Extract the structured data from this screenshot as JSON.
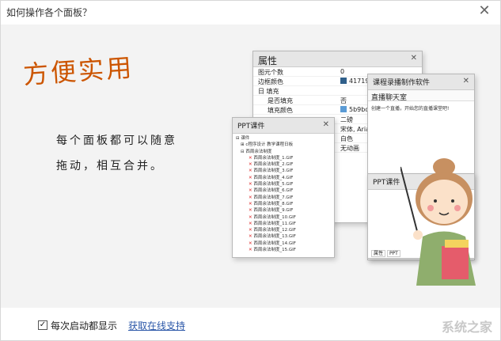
{
  "window": {
    "title": "如何操作各个面板？",
    "close_glyph": "✕"
  },
  "hero": {
    "headline": "方便实用",
    "line1": "每个面板都可以随意",
    "line2": "拖动，相互合并。"
  },
  "properties_panel": {
    "title": "属性",
    "rows": [
      {
        "key": "图元个数",
        "value": "0"
      },
      {
        "key": "边框颜色",
        "value": "41719"
      },
      {
        "key": "日 填充",
        "value": ""
      },
      {
        "key": "是否填充",
        "value": "否"
      },
      {
        "key": "填充颜色",
        "value": "5b9bd"
      },
      {
        "key": "",
        "value": "二磅"
      },
      {
        "key": "",
        "value": "宋体, Aria"
      },
      {
        "key": "",
        "value": "白色"
      },
      {
        "key": "",
        "value": "无动画"
      }
    ]
  },
  "course_panel": {
    "title": "课程录播制作软件",
    "subtitle": "直播聊天室",
    "note": "创建一个直播，开始您的直播课堂吧!"
  },
  "ppt_small_panel": {
    "title": "PPT课件",
    "tab1": "属性",
    "tab2": "PPT"
  },
  "ppt_panel": {
    "title": "PPT课件",
    "root": "课件",
    "folder1": "c程序设计 教学课程日板",
    "folder2": "西周余法制度",
    "files": [
      "西周余法制度_1.GIF",
      "西周余法制度_2.GIF",
      "西周余法制度_3.GIF",
      "西周余法制度_4.GIF",
      "西周余法制度_5.GIF",
      "西周余法制度_6.GIF",
      "西周余法制度_7.GIF",
      "西周余法制度_8.GIF",
      "西周余法制度_9.GIF",
      "西周余法制度_10.GIF",
      "西周余法制度_11.GIF",
      "西周余法制度_12.GIF",
      "西周余法制度_13.GIF",
      "西周余法制度_14.GIF",
      "西周余法制度_15.GIF"
    ]
  },
  "footer": {
    "checkbox_label": "每次启动都显示",
    "checked": true,
    "link_text": "获取在线支持"
  },
  "watermark": "系统之家"
}
